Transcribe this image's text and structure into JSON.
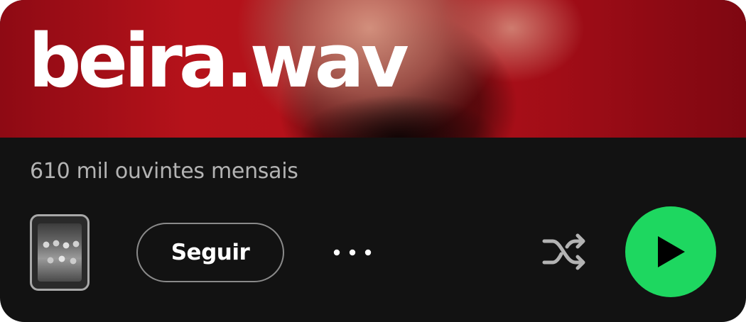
{
  "artist": {
    "name": "beira.wav",
    "monthly_listeners": "610 mil ouvintes mensais"
  },
  "actions": {
    "follow_label": "Seguir",
    "more_icon": "more-horizontal-icon",
    "shuffle_icon": "shuffle-icon",
    "play_icon": "play-icon"
  },
  "colors": {
    "hero_red": "#b5121a",
    "background": "#121212",
    "text_secondary": "#b3b3b3",
    "play_green": "#1ed760"
  }
}
